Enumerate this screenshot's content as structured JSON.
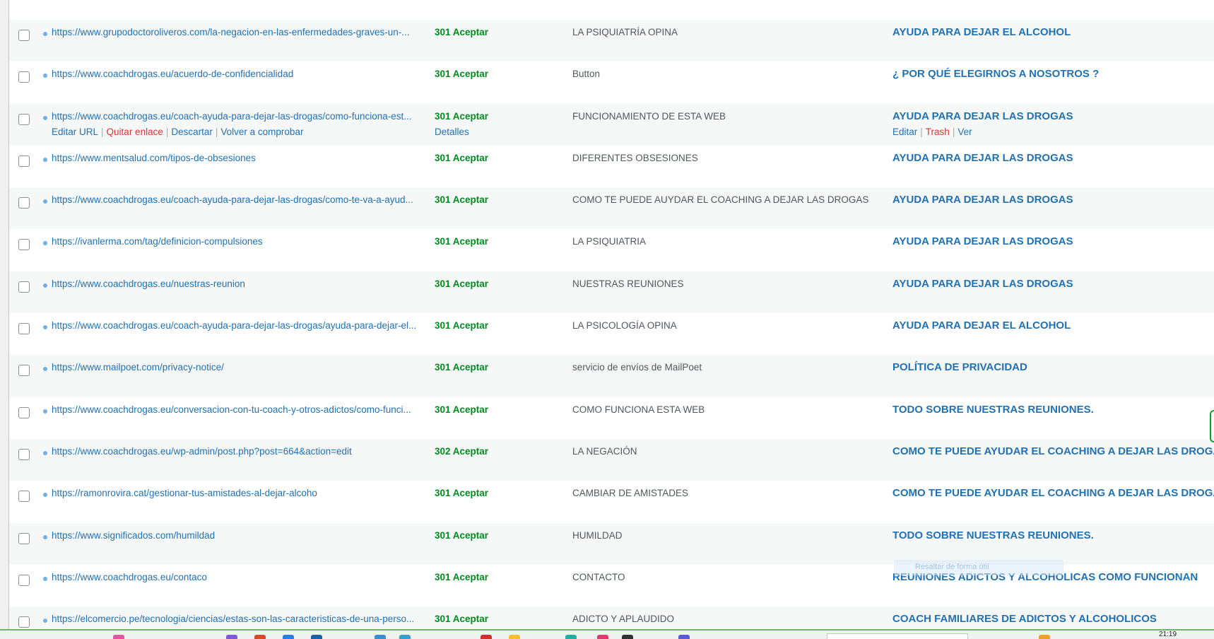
{
  "rows": [
    {
      "url": "https://www.grupodoctoroliveros.com/la-negacion-en-las-enfermedades-graves-un-...",
      "status": "301 Aceptar",
      "anchor": "LA PSIQUIATRÍA OPINA",
      "source": "AYUDA PARA DEJAR EL ALCOHOL"
    },
    {
      "url": "https://www.coachdrogas.eu/acuerdo-de-confidencialidad",
      "status": "301 Aceptar",
      "anchor": "Button",
      "source": "¿ POR QUÉ ELEGIRNOS A NOSOTROS ?"
    },
    {
      "url": "https://www.coachdrogas.eu/coach-ayuda-para-dejar-las-drogas/como-funciona-est...",
      "status": "301 Aceptar",
      "anchor": "FUNCIONAMIENTO DE ESTA WEB",
      "source": "AYUDA PARA DEJAR LAS DROGAS",
      "actions": {
        "edit_url": "Editar URL",
        "unlink": "Quitar enlace",
        "dismiss": "Descartar",
        "recheck": "Volver a comprobar",
        "sep": "|"
      },
      "details": "Detalles",
      "source_actions": {
        "edit": "Editar",
        "trash": "Trash",
        "view": "Ver",
        "sep": "|"
      }
    },
    {
      "url": "https://www.mentsalud.com/tipos-de-obsesiones",
      "status": "301 Aceptar",
      "anchor": "DIFERENTES OBSESIONES",
      "source": "AYUDA PARA DEJAR LAS DROGAS"
    },
    {
      "url": "https://www.coachdrogas.eu/coach-ayuda-para-dejar-las-drogas/como-te-va-a-ayud...",
      "status": "301 Aceptar",
      "anchor": "COMO TE PUEDE AUYDAR EL COACHING A DEJAR LAS DROGAS",
      "source": "AYUDA PARA DEJAR LAS DROGAS"
    },
    {
      "url": "https://ivanlerma.com/tag/definicion-compulsiones",
      "status": "301 Aceptar",
      "anchor": "LA PSIQUIATRIA",
      "source": "AYUDA PARA DEJAR LAS DROGAS"
    },
    {
      "url": "https://www.coachdrogas.eu/nuestras-reunion",
      "status": "301 Aceptar",
      "anchor": "NUESTRAS REUNIONES",
      "source": "AYUDA PARA DEJAR LAS DROGAS"
    },
    {
      "url": "https://www.coachdrogas.eu/coach-ayuda-para-dejar-las-drogas/ayuda-para-dejar-el...",
      "status": "301 Aceptar",
      "anchor": "LA PSICOLOGÍA OPINA",
      "source": "AYUDA PARA DEJAR EL ALCOHOL"
    },
    {
      "url": "https://www.mailpoet.com/privacy-notice/",
      "status": "301 Aceptar",
      "anchor": "servicio de envíos de MailPoet",
      "source": "POLÍTICA DE PRIVACIDAD"
    },
    {
      "url": "https://www.coachdrogas.eu/conversacion-con-tu-coach-y-otros-adictos/como-funci...",
      "status": "301 Aceptar",
      "anchor": "COMO FUNCIONA ESTA WEB",
      "source": "TODO SOBRE NUESTRAS REUNIONES."
    },
    {
      "url": "https://www.coachdrogas.eu/wp-admin/post.php?post=664&action=edit",
      "status": "302 Aceptar",
      "anchor": "LA NEGACIÓN",
      "source": "COMO TE PUEDE AYUDAR EL COACHING A DEJAR LAS DROGAS"
    },
    {
      "url": "https://ramonrovira.cat/gestionar-tus-amistades-al-dejar-alcoho",
      "status": "301 Aceptar",
      "anchor": "CAMBIAR DE AMISTADES",
      "source": "COMO TE PUEDE AYUDAR EL COACHING A DEJAR LAS DROGAS"
    },
    {
      "url": "https://www.significados.com/humildad",
      "status": "301 Aceptar",
      "anchor": "HUMILDAD",
      "source": "TODO SOBRE NUESTRAS REUNIONES."
    },
    {
      "url": "https://www.coachdrogas.eu/contaco",
      "status": "301 Aceptar",
      "anchor": "CONTACTO",
      "source": "REUNIONES ADICTOS Y ALCOHOLICAS COMO FUNCIONAN"
    },
    {
      "url": "https://elcomercio.pe/tecnologia/ciencias/estas-son-las-caracteristicas-de-una-perso...",
      "status": "301 Aceptar",
      "anchor": "ADICTO Y APLAUDIDO",
      "source": "COACH FAMILIARES DE ADICTOS Y ALCOHOLICOS"
    }
  ],
  "ghost_tooltip": "Resaltar de forma útil",
  "taskbar": {
    "time": "21:19"
  },
  "colors": {
    "link": "#2271b1",
    "ok_status": "#008a20",
    "danger": "#d63638",
    "row_alt": "#f6f7f7"
  }
}
